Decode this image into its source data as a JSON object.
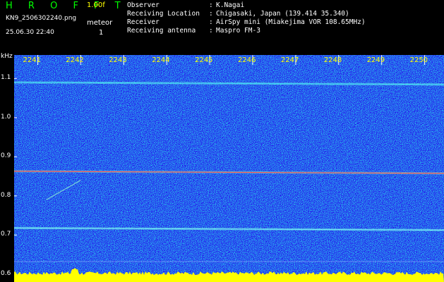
{
  "app": {
    "brand": "H R O F F T",
    "version": "1.00f"
  },
  "file": {
    "name": "KN9_2506302240.png",
    "datetime": "25.06.30 22:40"
  },
  "meteor": {
    "label": "meteor",
    "count": "1"
  },
  "info": [
    {
      "key": "Observer",
      "sep": ":",
      "value": "K.Nagai"
    },
    {
      "key": "Receiving Location",
      "sep": ":",
      "value": "Chigasaki, Japan (139.414 35.340)"
    },
    {
      "key": "Receiver",
      "sep": ":",
      "value": "AirSpy mini (Miakejima VOR 108.65MHz)"
    },
    {
      "key": "Receiving antenna",
      "sep": ":",
      "value": "Maspro FM-3"
    }
  ],
  "colors": {
    "background": "#000000",
    "noise": "#0a0fb4",
    "header_green": "#00ff00",
    "tick_yellow": "#ffff00",
    "baseline_yellow": "#ffff00"
  },
  "chart_data": {
    "type": "heatmap",
    "y_unit": "kHz",
    "y_ticks": [
      "1.1",
      "1.0",
      "0.9",
      "0.8",
      "0.7",
      "0.6"
    ],
    "x_ticks": [
      "2241",
      "2242",
      "2243",
      "2244",
      "2245",
      "2246",
      "2247",
      "2248",
      "2249",
      "2250"
    ],
    "ylim": [
      0.58,
      1.16
    ],
    "xlim": [
      2240.45,
      2250.45
    ],
    "traces": [
      {
        "name": "upper_carrier",
        "freq": 1.09,
        "color": "#3ad0ff"
      },
      {
        "name": "main_carrier",
        "freq": 0.863,
        "color": "#ff5050"
      },
      {
        "name": "lower_carrier",
        "freq": 0.718,
        "color": "#6fe3ff"
      }
    ],
    "meteor_echo": {
      "time_start": 2241.2,
      "time_end": 2242.0,
      "freq_start": 0.79,
      "freq_end": 0.84
    }
  }
}
